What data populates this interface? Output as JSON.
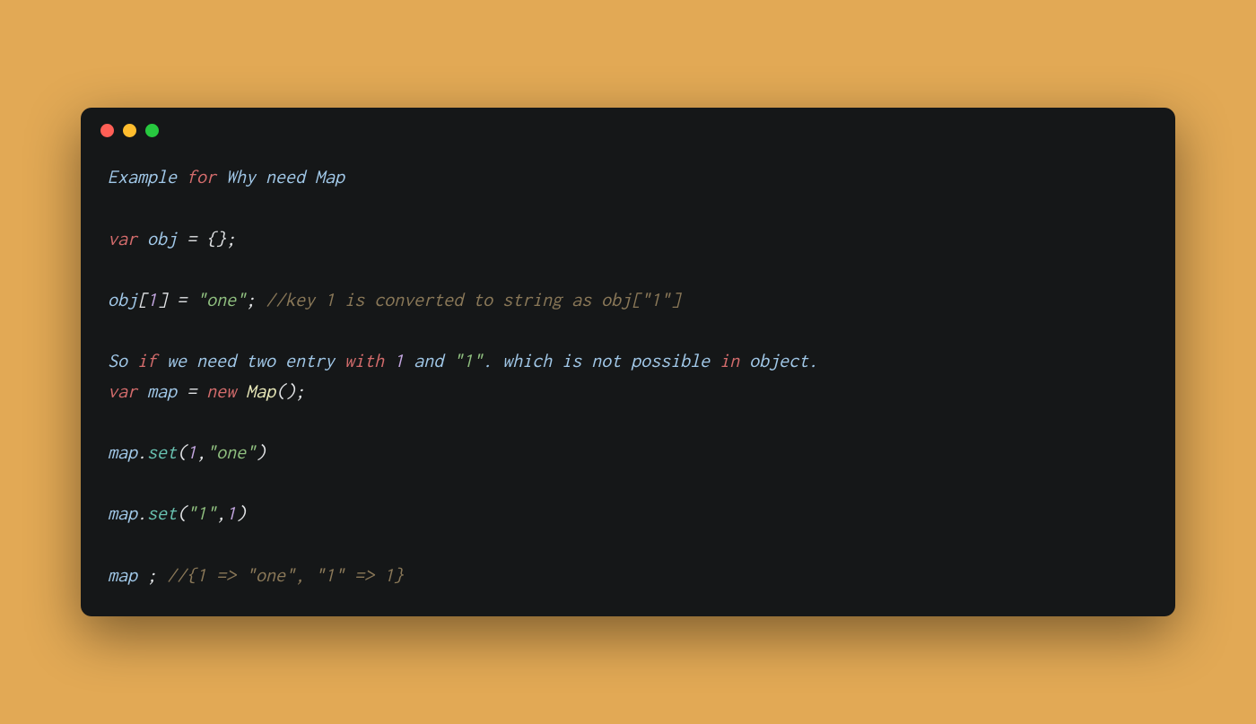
{
  "code": {
    "lines": [
      [
        {
          "t": "Example ",
          "c": "tok-ident"
        },
        {
          "t": "for",
          "c": "tok-keyword"
        },
        {
          "t": " Why need Map",
          "c": "tok-ident"
        }
      ],
      [],
      [
        {
          "t": "var",
          "c": "tok-keyword"
        },
        {
          "t": " ",
          "c": ""
        },
        {
          "t": "obj",
          "c": "tok-ident"
        },
        {
          "t": " ",
          "c": ""
        },
        {
          "t": "=",
          "c": "tok-punct"
        },
        {
          "t": " ",
          "c": ""
        },
        {
          "t": "{}",
          "c": "tok-punct"
        },
        {
          "t": ";",
          "c": "tok-punct"
        }
      ],
      [],
      [
        {
          "t": "obj",
          "c": "tok-ident"
        },
        {
          "t": "[",
          "c": "tok-punct"
        },
        {
          "t": "1",
          "c": "tok-number"
        },
        {
          "t": "]",
          "c": "tok-punct"
        },
        {
          "t": " ",
          "c": ""
        },
        {
          "t": "=",
          "c": "tok-punct"
        },
        {
          "t": " ",
          "c": ""
        },
        {
          "t": "\"one\"",
          "c": "tok-string"
        },
        {
          "t": ";",
          "c": "tok-punct"
        },
        {
          "t": " ",
          "c": ""
        },
        {
          "t": "//key 1 is converted to string as obj[\"1\"]",
          "c": "tok-comment"
        }
      ],
      [],
      [
        {
          "t": "So ",
          "c": "tok-ident"
        },
        {
          "t": "if",
          "c": "tok-keyword"
        },
        {
          "t": " we need two entry ",
          "c": "tok-ident"
        },
        {
          "t": "with",
          "c": "tok-keyword"
        },
        {
          "t": " ",
          "c": ""
        },
        {
          "t": "1",
          "c": "tok-number"
        },
        {
          "t": " and ",
          "c": "tok-ident"
        },
        {
          "t": "\"1\"",
          "c": "tok-string"
        },
        {
          "t": ". which is not possible ",
          "c": "tok-ident"
        },
        {
          "t": "in",
          "c": "tok-keyword"
        },
        {
          "t": " object.",
          "c": "tok-ident"
        }
      ],
      [
        {
          "t": "var",
          "c": "tok-keyword"
        },
        {
          "t": " ",
          "c": ""
        },
        {
          "t": "map",
          "c": "tok-ident"
        },
        {
          "t": " ",
          "c": ""
        },
        {
          "t": "=",
          "c": "tok-punct"
        },
        {
          "t": " ",
          "c": ""
        },
        {
          "t": "new",
          "c": "tok-keyword"
        },
        {
          "t": " ",
          "c": ""
        },
        {
          "t": "Map",
          "c": "tok-type"
        },
        {
          "t": "();",
          "c": "tok-punct"
        }
      ],
      [],
      [
        {
          "t": "map",
          "c": "tok-ident"
        },
        {
          "t": ".",
          "c": "tok-punct"
        },
        {
          "t": "set",
          "c": "tok-method"
        },
        {
          "t": "(",
          "c": "tok-punct"
        },
        {
          "t": "1",
          "c": "tok-number"
        },
        {
          "t": ",",
          "c": "tok-punct"
        },
        {
          "t": "\"one\"",
          "c": "tok-string"
        },
        {
          "t": ")",
          "c": "tok-punct"
        }
      ],
      [],
      [
        {
          "t": "map",
          "c": "tok-ident"
        },
        {
          "t": ".",
          "c": "tok-punct"
        },
        {
          "t": "set",
          "c": "tok-method"
        },
        {
          "t": "(",
          "c": "tok-punct"
        },
        {
          "t": "\"1\"",
          "c": "tok-string"
        },
        {
          "t": ",",
          "c": "tok-punct"
        },
        {
          "t": "1",
          "c": "tok-number"
        },
        {
          "t": ")",
          "c": "tok-punct"
        }
      ],
      [],
      [
        {
          "t": "map ",
          "c": "tok-ident"
        },
        {
          "t": ";",
          "c": "tok-punct"
        },
        {
          "t": " ",
          "c": ""
        },
        {
          "t": "//{1 => \"one\", \"1\" => 1}",
          "c": "tok-comment"
        }
      ]
    ]
  }
}
